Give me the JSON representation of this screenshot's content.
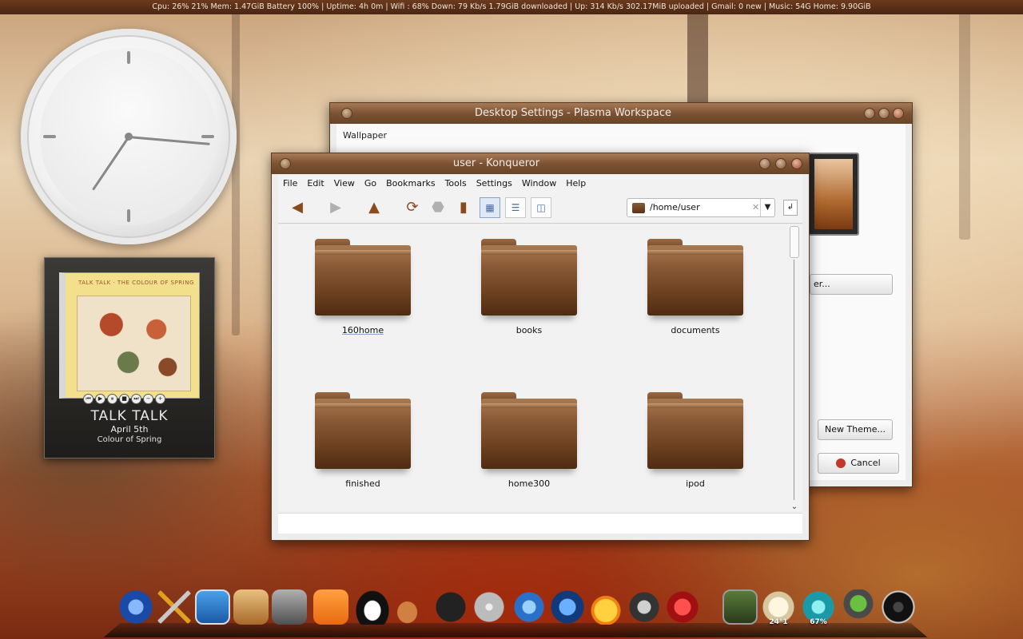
{
  "statusbar": {
    "text": "Cpu: 26% 21%  Mem: 1.47GiB Battery 100%  |  Uptime: 4h 0m  |  Wifi : 68%  Down: 79 Kb/s  1.79GiB downloaded  |  Up:  314 Kb/s  302.17MiB uploaded  | Gmail: 0 new  |  Music: 54G  Home: 9.90GiB"
  },
  "music": {
    "cover_title": "TALK TALK · THE COLOUR OF SPRING",
    "artist": "TALK  TALK",
    "track": "April 5th",
    "album": "Colour of Spring",
    "controls": [
      "⏮",
      "▶",
      "⏸",
      "■",
      "⏭",
      "−",
      "+"
    ]
  },
  "desktop_settings": {
    "title": "Desktop Settings - Plasma Workspace",
    "wallpaper_label": "Wallpaper",
    "partial_button": "er...",
    "new_theme": "New Theme...",
    "cancel": "Cancel"
  },
  "konqueror": {
    "title": "user - Konqueror",
    "menu": [
      "File",
      "Edit",
      "View",
      "Go",
      "Bookmarks",
      "Tools",
      "Settings",
      "Window",
      "Help"
    ],
    "location": "/home/user",
    "folders": [
      "160home",
      "books",
      "documents",
      "finished",
      "home300",
      "ipod"
    ]
  },
  "dock": {
    "weather_temp": "24°1",
    "wifi_percent": "67%"
  },
  "colors": {
    "accent_brown": "#7b5233",
    "cancel_red": "#c0392b"
  }
}
